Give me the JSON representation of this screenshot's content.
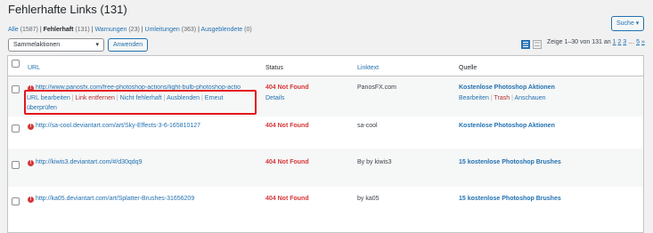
{
  "page": {
    "title": "Fehlerhafte Links (131)"
  },
  "search_button": "Suche ▾",
  "filters": [
    {
      "label": "Alle",
      "count": "(1587)",
      "current": false
    },
    {
      "label": "Fehlerhaft",
      "count": "(131)",
      "current": true
    },
    {
      "label": "Warnungen",
      "count": "(23)",
      "current": false
    },
    {
      "label": "Umleitungen",
      "count": "(363)",
      "current": false
    },
    {
      "label": "Ausgeblendete",
      "count": "(0)",
      "current": false
    }
  ],
  "bulk": {
    "selected": "Sammelaktionen",
    "apply": "Anwenden"
  },
  "pagination": {
    "info": "Zeige 1–30 von 131 an",
    "pages": [
      "1",
      "2",
      "3",
      "…",
      "5",
      "»"
    ]
  },
  "columns": {
    "url": "URL",
    "status": "Status",
    "linktext": "Linktext",
    "source": "Quelle"
  },
  "rows": [
    {
      "url": "http://www.panosfx.com/free-photoshop-actions/light-bulb-photoshop-actio",
      "status": "404 Not Found",
      "details": "Details",
      "linktext": "PanosFX.com",
      "source": "Kostenlose Photoshop Aktionen",
      "source_actions": [
        "Bearbeiten",
        "Trash",
        "Anschauen"
      ],
      "row_actions": {
        "edit": "URL bearbeiten",
        "unlink": "Link entfernen",
        "not_broken": "Nicht fehlerhaft",
        "dismiss": "Ausblenden",
        "recheck": "Erneut",
        "recheck2": "überprüfen"
      }
    },
    {
      "url": "http://sa-cool.deviantart.com/art/Sky-Effects-3-6-165810127",
      "status": "404 Not Found",
      "linktext": "sa-cool",
      "source": "Kostenlose Photoshop Aktionen"
    },
    {
      "url": "http://kiwis3.deviantart.com/#/d30qdq9",
      "status": "404 Not Found",
      "linktext": "By by kiwis3",
      "source": "15 kostenlose Photoshop Brushes"
    },
    {
      "url": "http://ka05.deviantart.com/art/Splatter-Brushes-31656209",
      "status": "404 Not Found",
      "linktext": "by ka05",
      "source": "15 kostenlose Photoshop Brushes"
    }
  ],
  "colors": {
    "accent": "#2271b1",
    "error": "#d63638",
    "highlight_box": "#e3161b"
  }
}
